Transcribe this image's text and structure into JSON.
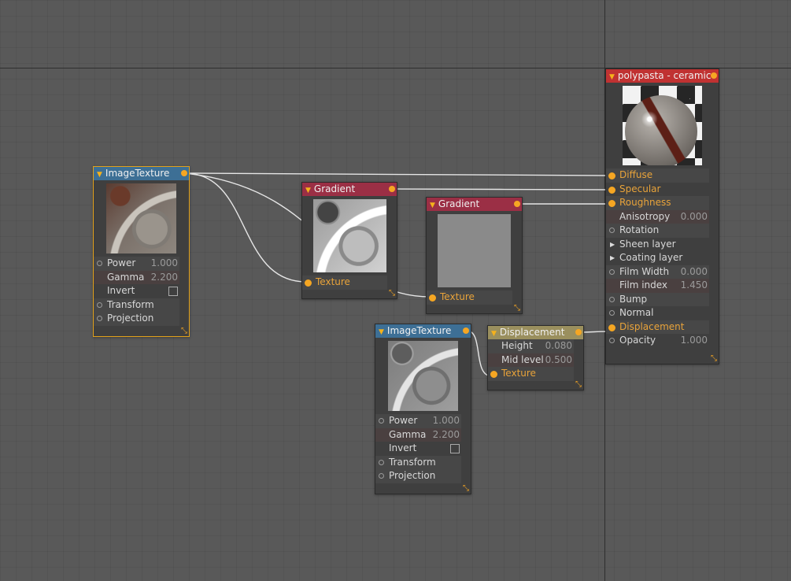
{
  "nodes": {
    "image_texture_1": {
      "title": "ImageTexture",
      "params": [
        {
          "label": "Power",
          "value": "1.000"
        },
        {
          "label": "Gamma",
          "value": "2.200"
        },
        {
          "label": "Invert",
          "value": ""
        },
        {
          "label": "Transform",
          "value": ""
        },
        {
          "label": "Projection",
          "value": ""
        }
      ]
    },
    "gradient_1": {
      "title": "Gradient",
      "input": "Texture"
    },
    "gradient_2": {
      "title": "Gradient",
      "input": "Texture"
    },
    "image_texture_2": {
      "title": "ImageTexture",
      "params": [
        {
          "label": "Power",
          "value": "1.000"
        },
        {
          "label": "Gamma",
          "value": "2.200"
        },
        {
          "label": "Invert",
          "value": ""
        },
        {
          "label": "Transform",
          "value": ""
        },
        {
          "label": "Projection",
          "value": ""
        }
      ]
    },
    "displacement": {
      "title": "Displacement",
      "params": [
        {
          "label": "Height",
          "value": "0.080"
        },
        {
          "label": "Mid level",
          "value": "0.500"
        },
        {
          "label": "Texture",
          "value": ""
        }
      ]
    },
    "material": {
      "title": "polypasta - ceramic",
      "params": [
        {
          "label": "Diffuse",
          "value": ""
        },
        {
          "label": "Specular",
          "value": ""
        },
        {
          "label": "Roughness",
          "value": ""
        },
        {
          "label": "Anisotropy",
          "value": "0.000"
        },
        {
          "label": "Rotation",
          "value": ""
        },
        {
          "label": "Sheen layer",
          "value": ""
        },
        {
          "label": "Coating layer",
          "value": ""
        },
        {
          "label": "Film Width",
          "value": "0.000"
        },
        {
          "label": "Film index",
          "value": "1.450"
        },
        {
          "label": "Bump",
          "value": ""
        },
        {
          "label": "Normal",
          "value": ""
        },
        {
          "label": "Displacement",
          "value": ""
        },
        {
          "label": "Opacity",
          "value": "1.000"
        }
      ]
    }
  },
  "colors": {
    "canvas": "#595959",
    "node_body": "#3f3f3f",
    "header_image_texture": "#3d6f95",
    "header_gradient": "#9b2f45",
    "header_displacement": "#9a8f5e",
    "header_material": "#c03232",
    "pin_connected": "#f5a623",
    "selection_outline": "#e3a21a"
  },
  "icons": [
    "collapse-triangle-icon",
    "output-pin-icon",
    "input-pin-icon",
    "expand-arrow-icon",
    "resize-handle-icon",
    "checkbox-icon"
  ]
}
